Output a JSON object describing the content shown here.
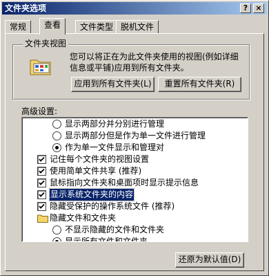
{
  "window": {
    "title": "文件夹选项",
    "help_label": "?",
    "close_label": "×"
  },
  "tabs": [
    {
      "label": "常规",
      "active": false
    },
    {
      "label": "查看",
      "active": true
    },
    {
      "label": "文件类型",
      "active": false
    },
    {
      "label": "脱机文件",
      "active": false
    }
  ],
  "folder_views": {
    "legend": "文件夹视图",
    "description": "您可以将正在为此文件夹使用的视图(例如详细信息或平铺)应用到所有文件夹。",
    "apply_button": "应用到所有文件夹(L)",
    "reset_button": "重置所有文件夹(R)"
  },
  "advanced": {
    "label": "高级设置:",
    "items": [
      {
        "type": "radio",
        "checked": false,
        "indent": 1,
        "label": "显示两部分并分别进行管理"
      },
      {
        "type": "radio",
        "checked": false,
        "indent": 1,
        "label": "显示两部分但是作为单一文件进行管理"
      },
      {
        "type": "radio",
        "checked": true,
        "indent": 1,
        "label": "作为单一文件显示和管理对"
      },
      {
        "type": "checkbox",
        "checked": true,
        "indent": 0,
        "label": "记住每个文件夹的视图设置"
      },
      {
        "type": "checkbox",
        "checked": true,
        "indent": 0,
        "label": "使用简单文件共享 (推荐)"
      },
      {
        "type": "checkbox",
        "checked": true,
        "indent": 0,
        "label": "鼠标指向文件夹和桌面项时显示提示信息"
      },
      {
        "type": "checkbox",
        "checked": true,
        "indent": 0,
        "label": "显示系统文件夹的内容",
        "selected": true
      },
      {
        "type": "checkbox",
        "checked": true,
        "indent": 0,
        "label": "隐藏受保护的操作系统文件 (推荐)"
      },
      {
        "type": "folder",
        "indent": 0,
        "label": "隐藏文件和文件夹"
      },
      {
        "type": "radio",
        "checked": false,
        "indent": 1,
        "label": "不显示隐藏的文件和文件夹"
      },
      {
        "type": "radio",
        "checked": true,
        "indent": 1,
        "label": "显示所有文件和文件夹"
      }
    ],
    "restore_button": "还原为默认值(D)"
  }
}
